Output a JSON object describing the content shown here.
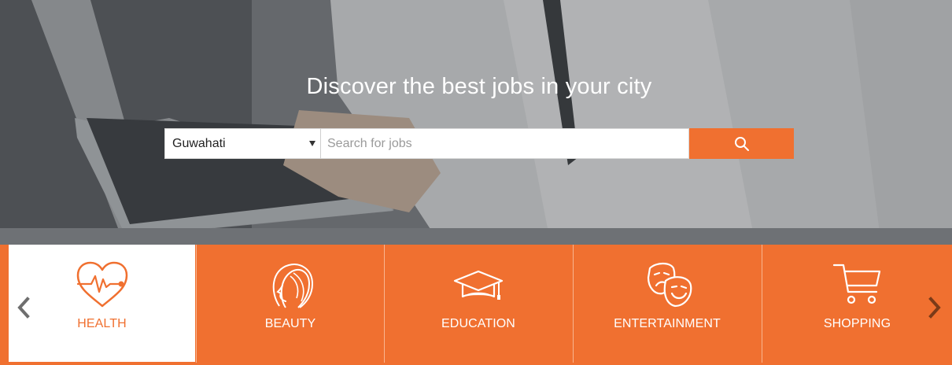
{
  "hero": {
    "title": "Discover the best jobs in your city"
  },
  "search": {
    "city_value": "Guwahati",
    "placeholder": "Search for jobs",
    "query_value": "",
    "button_icon": "search-icon"
  },
  "categories": [
    {
      "label": "HEALTH",
      "icon": "heart-pulse-icon",
      "active": true
    },
    {
      "label": "BEAUTY",
      "icon": "woman-face-icon",
      "active": false
    },
    {
      "label": "EDUCATION",
      "icon": "graduation-cap-icon",
      "active": false
    },
    {
      "label": "ENTERTAINMENT",
      "icon": "theater-masks-icon",
      "active": false
    },
    {
      "label": "SHOPPING",
      "icon": "shopping-cart-icon",
      "active": false
    }
  ],
  "carousel": {
    "prev_icon": "chevron-left-icon",
    "next_icon": "chevron-right-icon"
  },
  "colors": {
    "accent": "#f07030",
    "white": "#ffffff"
  }
}
